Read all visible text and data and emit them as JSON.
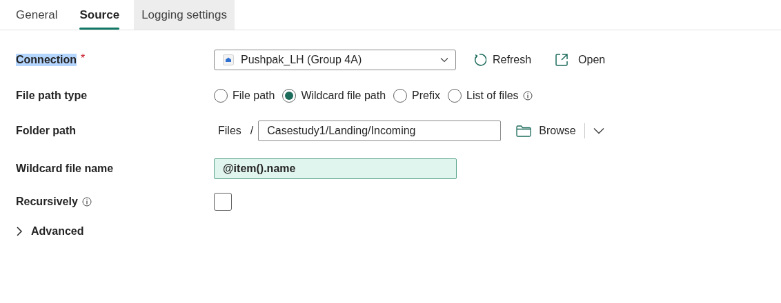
{
  "tabs": [
    {
      "label": "General",
      "selected": false,
      "hovered": false
    },
    {
      "label": "Source",
      "selected": true,
      "hovered": false
    },
    {
      "label": "Logging settings",
      "selected": false,
      "hovered": true
    }
  ],
  "connection": {
    "label": "Connection",
    "highlighted": true,
    "required_mark": "*",
    "value": "Pushpak_LH (Group 4A)",
    "refresh": "Refresh",
    "open": "Open"
  },
  "file_path_type": {
    "label": "File path type",
    "options": [
      {
        "label": "File path",
        "selected": false,
        "info": false
      },
      {
        "label": "Wildcard file path",
        "selected": true,
        "info": false
      },
      {
        "label": "Prefix",
        "selected": false,
        "info": false
      },
      {
        "label": "List of files",
        "selected": false,
        "info": true
      }
    ]
  },
  "folder_path": {
    "label": "Folder path",
    "root": "Files",
    "separator": "/",
    "value": "Casestudy1/Landing/Incoming",
    "browse": "Browse"
  },
  "wildcard_file_name": {
    "label": "Wildcard file name",
    "value": "@item().name",
    "dynamic": true
  },
  "recursively": {
    "label": "Recursively",
    "checked": false
  },
  "advanced": {
    "label": "Advanced",
    "expanded": false
  }
}
